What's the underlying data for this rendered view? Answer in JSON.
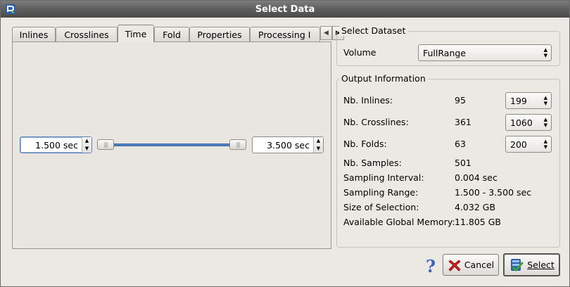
{
  "window": {
    "title": "Select Data"
  },
  "tabs": [
    {
      "label": "Inlines"
    },
    {
      "label": "Crosslines"
    },
    {
      "label": "Time",
      "active": true
    },
    {
      "label": "Fold"
    },
    {
      "label": "Properties"
    },
    {
      "label": "Processing I"
    }
  ],
  "time_panel": {
    "start": "1.500 sec",
    "end": "3.500 sec"
  },
  "select_dataset": {
    "group_title": "Select Dataset",
    "label": "Volume",
    "value": "FullRange"
  },
  "output_info": {
    "group_title": "Output Information",
    "rows": [
      {
        "label": "Nb. Inlines:",
        "value": "95",
        "spin": "199"
      },
      {
        "label": "Nb. Crosslines:",
        "value": "361",
        "spin": "1060"
      },
      {
        "label": "Nb. Folds:",
        "value": "63",
        "spin": "200"
      },
      {
        "label": "Nb. Samples:",
        "value": "501"
      },
      {
        "label": "Sampling Interval:",
        "value": "0.004 sec"
      },
      {
        "label": "Sampling Range:",
        "value": "1.500 - 3.500 sec"
      },
      {
        "label": "Size of Selection:",
        "value": "4.032 GB"
      },
      {
        "label": "Available Global Memory:",
        "value": "11.805 GB"
      }
    ]
  },
  "buttons": {
    "help": "?",
    "cancel": "Cancel",
    "select": "Select"
  },
  "icons": {
    "app": "app-logo-icon",
    "help": "question-icon",
    "cancel": "red-x-icon",
    "select": "check-icon"
  },
  "colors": {
    "accent": "#4f7fbf",
    "titlebar": "#5e5e5e",
    "help": "#3a63b8",
    "cancel": "#d22020"
  }
}
